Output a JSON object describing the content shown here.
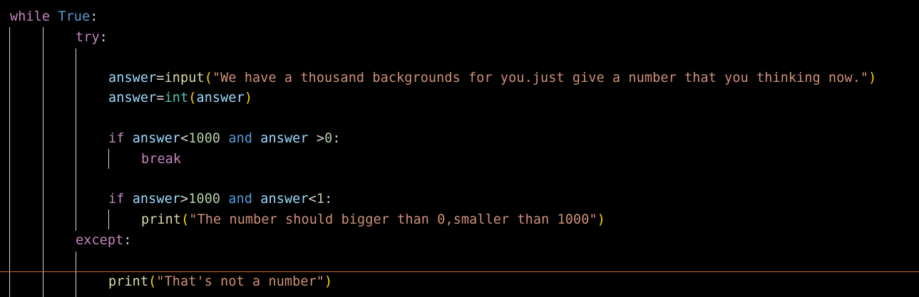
{
  "editor": {
    "language": "python",
    "theme_colors": {
      "background": "#000000",
      "keyword_control": "#c586c0",
      "keyword_constant": "#569cd6",
      "variable": "#9cdcfe",
      "function": "#dcdcaa",
      "builtin_class": "#4ec9b0",
      "string": "#ce9178",
      "number": "#b5cea8",
      "bracket_level1": "#ffd700",
      "bracket_level2": "#da70d6",
      "indent_guide": "#d8d8d8",
      "current_line_border": "#c8692f"
    },
    "lines": {
      "l1": {
        "kw": "while",
        "const": "True",
        "colon": ":"
      },
      "l2": {
        "kw": "try",
        "colon": ":"
      },
      "l4": {
        "var": "answer",
        "eq": "=",
        "fn": "input",
        "open": "(",
        "str": "\"We have a thousand backgrounds for you.just give a number that you thinking now.\"",
        "close": ")"
      },
      "l5": {
        "var": "answer",
        "eq": "=",
        "fn": "int",
        "open": "(",
        "arg": "answer",
        "close": ")"
      },
      "l7": {
        "kw": "if",
        "var1": "answer",
        "op1": "<",
        "num1": "1000",
        "and": "and",
        "var2": "answer",
        "op2": " >",
        "num2": "0",
        "colon": ":"
      },
      "l8": {
        "kw": "break"
      },
      "l10": {
        "kw": "if",
        "var1": "answer",
        "op1": ">",
        "num1": "1000",
        "and": "and",
        "var2": "answer",
        "op2": "<",
        "num2": "1",
        "colon": ":"
      },
      "l11": {
        "fn": "print",
        "open": "(",
        "str": "\"The number should bigger than 0,smaller than 1000\"",
        "close": ")"
      },
      "l12": {
        "kw": "except",
        "colon": ":"
      },
      "l14": {
        "fn": "print",
        "open": "(",
        "str": "\"That's not a number\"",
        "close": ")"
      }
    }
  }
}
